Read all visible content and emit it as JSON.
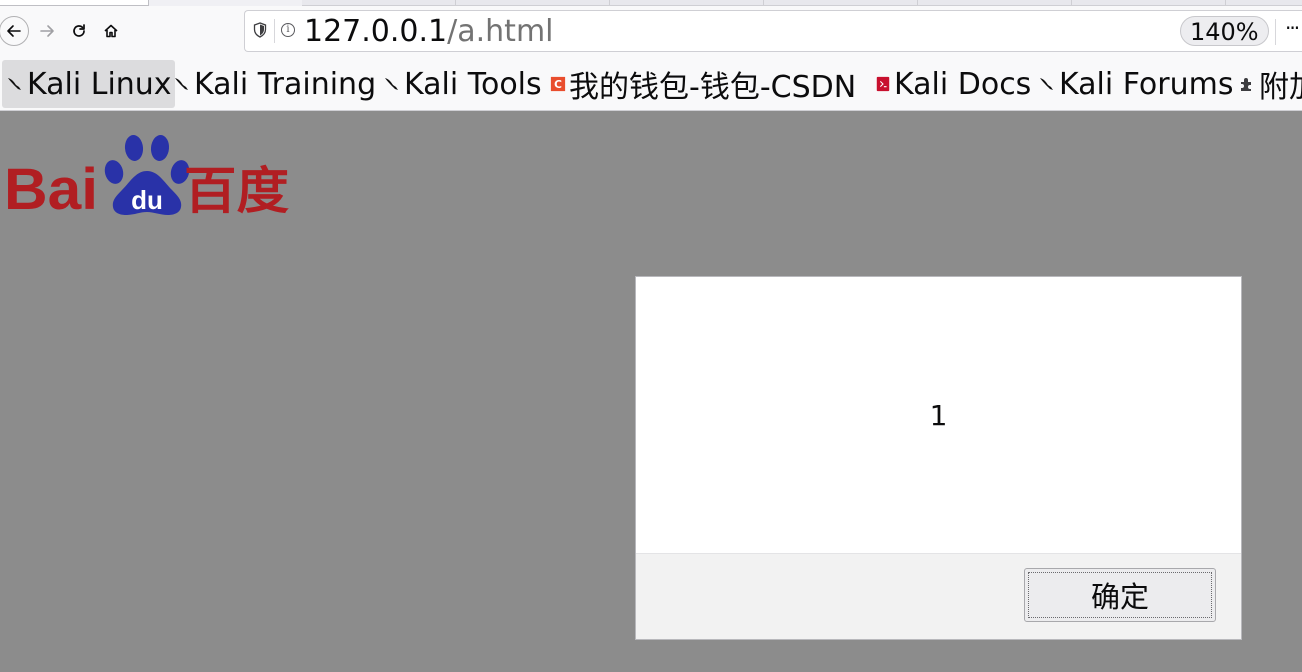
{
  "browser": {
    "url_host": "127.0.0.1",
    "url_path": "/a.html",
    "zoom": "140%",
    "page_actions": "···",
    "nav_icons": [
      "back-arrow-icon",
      "forward-arrow-icon",
      "reload-icon",
      "home-icon"
    ]
  },
  "bookmarks": [
    {
      "label": "Kali Linux",
      "icon": "kali-dragon-icon",
      "active": true
    },
    {
      "label": "Kali Training",
      "icon": "kali-dragon-icon"
    },
    {
      "label": "Kali Tools",
      "icon": "kali-dragon-icon"
    },
    {
      "label": "我的钱包-钱包-CSDN",
      "icon": "csdn-icon",
      "icon_color": "#e94d2d"
    },
    {
      "label": "Kali Docs",
      "icon": "kali-docs-icon",
      "icon_color": "#c8102e"
    },
    {
      "label": "Kali Forums",
      "icon": "kali-dragon-icon"
    },
    {
      "label": "附加",
      "icon": "puzzle-icon"
    }
  ],
  "page": {
    "background": "#8c8c8c",
    "logo": {
      "text": "Bai",
      "paw_text": "du",
      "cn_text": "百度",
      "red": "#b11e22",
      "blue": "#2932a8"
    }
  },
  "dialog": {
    "message": "1",
    "ok_label": "确定"
  }
}
